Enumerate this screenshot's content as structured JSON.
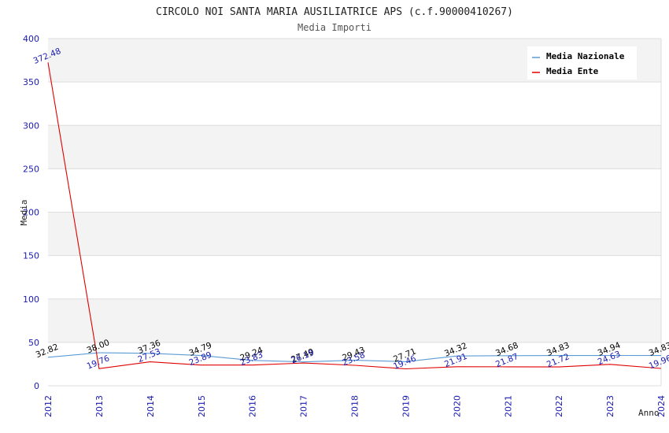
{
  "chart_data": {
    "type": "line",
    "title": "CIRCOLO NOI SANTA MARIA AUSILIATRICE APS (c.f.90000410267)",
    "subtitle": "Media Importi",
    "xlabel": "Anno",
    "ylabel": "Media",
    "categories": [
      "2012",
      "2013",
      "2014",
      "2015",
      "2016",
      "2017",
      "2018",
      "2019",
      "2020",
      "2021",
      "2022",
      "2023",
      "2024"
    ],
    "ylim": [
      0,
      400
    ],
    "yticks": [
      0,
      50,
      100,
      150,
      200,
      250,
      300,
      350,
      400
    ],
    "grid": true,
    "legend_position": "top-right",
    "series": [
      {
        "name": "Media Nazionale",
        "color": "#5b9bd5",
        "label_color": "#000000",
        "values": [
          32.82,
          38.0,
          37.36,
          34.79,
          29.24,
          27.49,
          29.43,
          27.71,
          34.32,
          34.68,
          34.83,
          34.94,
          34.83
        ],
        "labels": [
          "32.82",
          "38.00",
          "37.36",
          "34.79",
          "29.24",
          "27.49",
          "29.43",
          "27.71",
          "34.32",
          "34.68",
          "34.83",
          "34.94",
          "34.83"
        ]
      },
      {
        "name": "Media Ente",
        "color": "#e00000",
        "label_color": "#1a1ab0",
        "values": [
          372.48,
          19.76,
          27.53,
          23.89,
          23.83,
          26.19,
          23.58,
          19.46,
          21.91,
          21.87,
          21.72,
          24.63,
          19.96
        ],
        "labels": [
          "372.48",
          "19.76",
          "27.53",
          "23.89",
          "23.83",
          "26.19",
          "23.58",
          "19.46",
          "21.91",
          "21.87",
          "21.72",
          "24.63",
          "19.96"
        ]
      }
    ]
  }
}
